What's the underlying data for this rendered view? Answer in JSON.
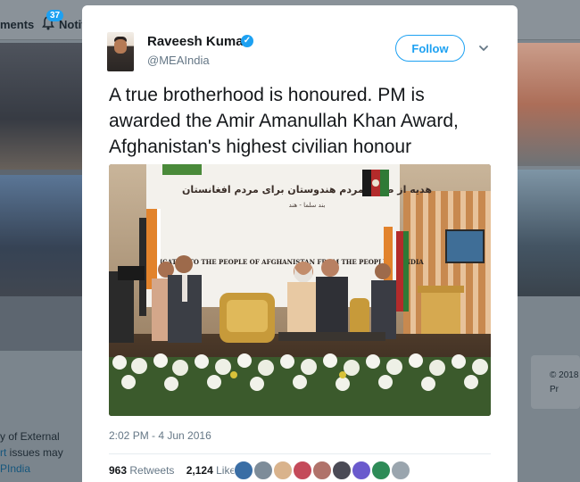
{
  "topbar": {
    "nav_left_label": "ments",
    "notif_label": "Notif",
    "notif_count": "37"
  },
  "left_sidebar": {
    "text_line1": "y of External",
    "text_line2_link": "rt",
    "text_line2_rest": " issues may",
    "text_line3_link": "PIndia"
  },
  "right_sidebar": {
    "footer_line1": "© 2018",
    "footer_line2": "Pr"
  },
  "tweet": {
    "author_name": "Raveesh Kumar",
    "author_handle": "@MEAIndia",
    "verified": true,
    "follow_label": "Follow",
    "text": "A true brotherhood is honoured. PM is awarded the Amir Amanullah Khan Award, Afghanistan's highest civilian honour",
    "timestamp": "2:02 PM - 4 Jun 2016",
    "retweets_count": "963",
    "retweets_label": "Retweets",
    "likes_count": "2,124",
    "likes_label": "Likes"
  },
  "photo": {
    "banner_line_farsi": "هدیه از طرف مردم هندوستان برای مردم افغانستان",
    "banner_line_sub1": "بند سلما - هند",
    "banner_line_english": "DEDICATED TO THE PEOPLE OF AFGHANISTAN FROM THE PEOPLE OF INDIA"
  },
  "colors": {
    "accent": "#1da1f2",
    "text_primary": "#14171a",
    "text_secondary": "#657786"
  },
  "icons": {
    "bell": "bell-icon",
    "verified": "verified-badge-icon",
    "chevron": "chevron-down-icon"
  }
}
